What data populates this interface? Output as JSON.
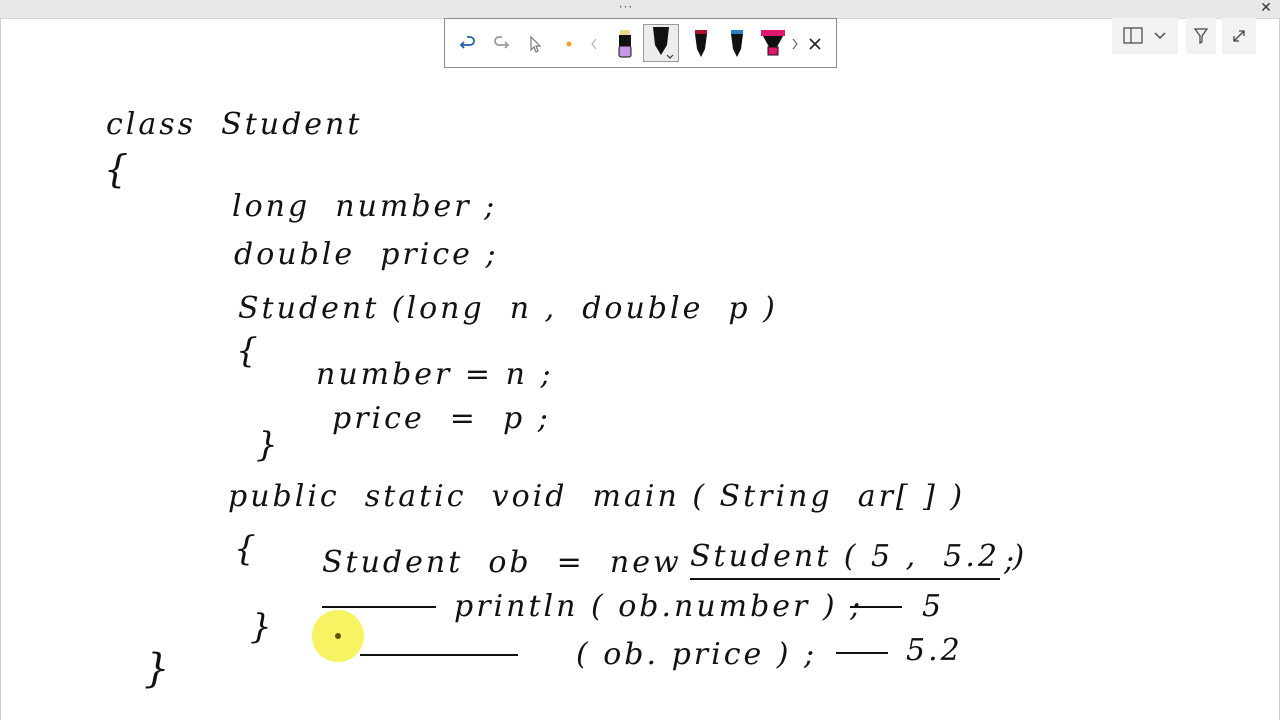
{
  "window": {
    "grip": "···",
    "close": "✕"
  },
  "toolbar": {
    "items": [
      {
        "name": "undo-icon"
      },
      {
        "name": "redo-icon"
      },
      {
        "name": "select-icon"
      },
      {
        "name": "pointer-dot-icon"
      },
      {
        "name": "scroll-left-chevron-icon"
      },
      {
        "name": "highlighter-purple-icon"
      },
      {
        "name": "pen-black-icon"
      },
      {
        "name": "pen-red-icon"
      },
      {
        "name": "pen-blue-icon"
      },
      {
        "name": "highlighter-pink-icon"
      },
      {
        "name": "scroll-right-chevron-icon"
      },
      {
        "name": "close-icon"
      }
    ],
    "colors": {
      "undo": "#1f5fa8",
      "highlighter_purple": "#c896e6",
      "pen_red": "#b0102c",
      "pen_blue": "#2a7ec8",
      "highlighter_pink": "#e0186c"
    }
  },
  "right_tools": [
    {
      "name": "page-view-icon"
    },
    {
      "name": "dropdown-chevron-icon"
    },
    {
      "name": "funnel-icon"
    },
    {
      "name": "expand-icon"
    }
  ],
  "handwriting": {
    "line1": "class  Student",
    "brace_open": "{",
    "line2": "long  number ;",
    "line3": "double  price ;",
    "line4": "Student (long  n ,  double  p )",
    "brace2_open": "{",
    "line5": "number = n ;",
    "line6": "price  =  p ;",
    "brace2_close": "}",
    "line7": "public  static  void  main ( String  ar[ ] )",
    "brace3_open": "{",
    "line8a": "Student  ob  =  new",
    "line8b": "Student ( 5 ,  5.2 )",
    "line8c": ";",
    "line9": "println ( ob.number ) ;",
    "line9_result": "5",
    "line10": "( ob. price ) ;",
    "line10_result": "5.2",
    "brace3_close": "}",
    "brace_close": "}"
  }
}
